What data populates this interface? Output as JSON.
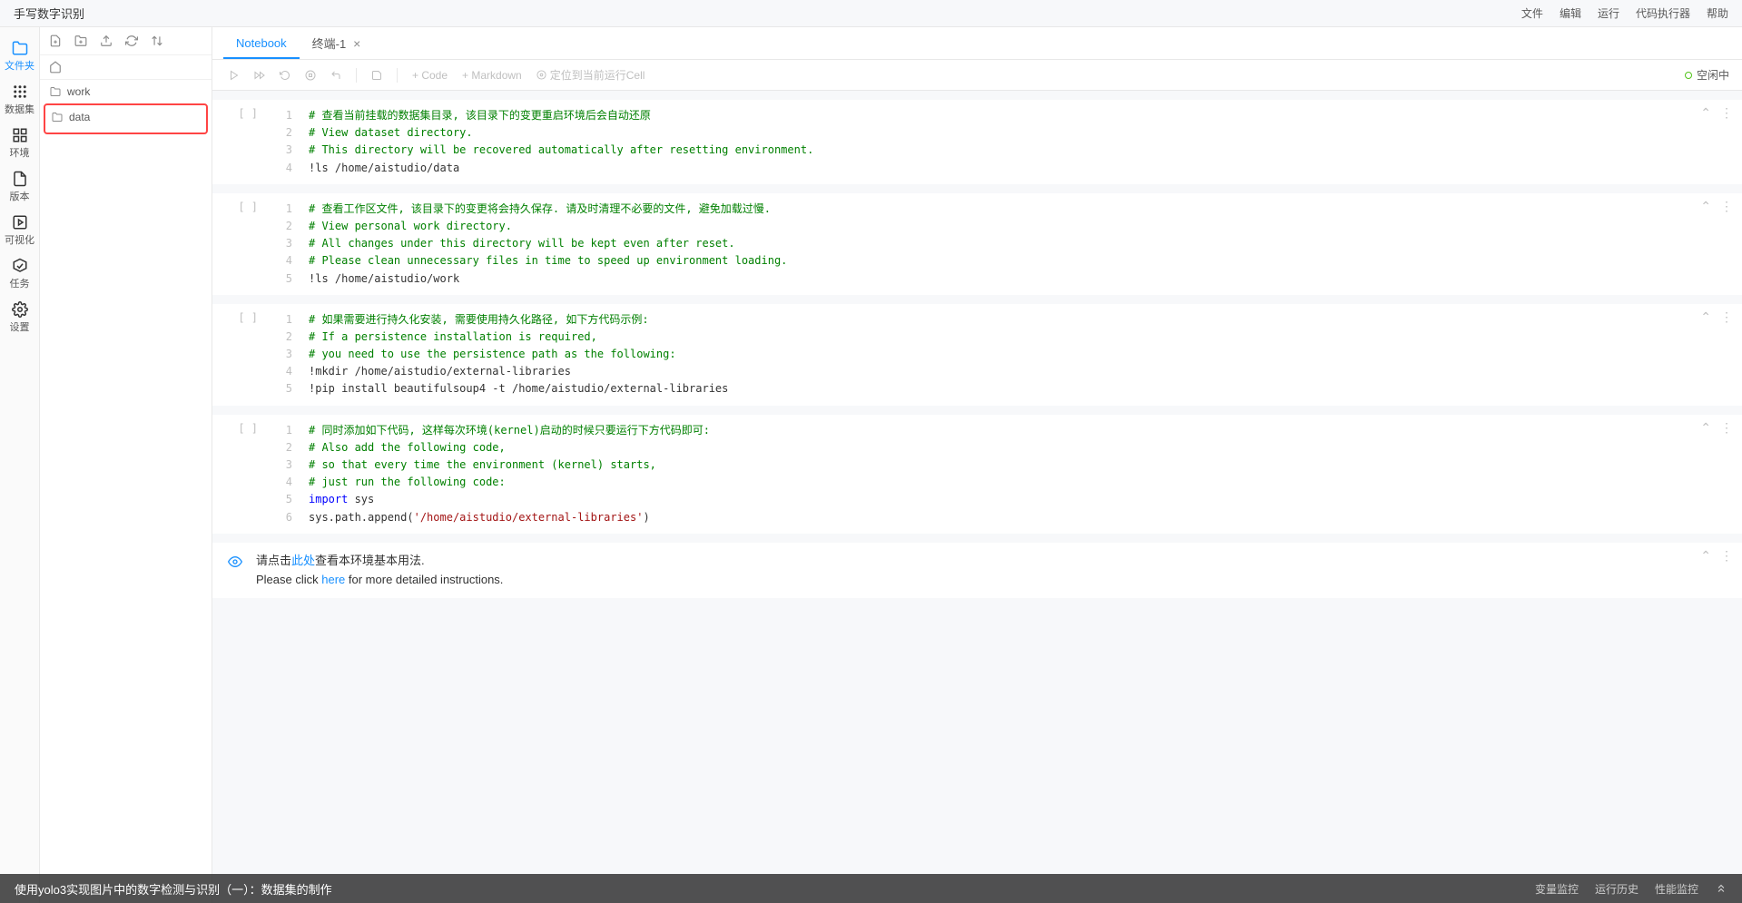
{
  "title": "手写数字识别",
  "topMenu": [
    "文件",
    "编辑",
    "运行",
    "代码执行器",
    "帮助"
  ],
  "iconSidebar": [
    {
      "label": "文件夹",
      "icon": "folder",
      "active": true
    },
    {
      "label": "数据集",
      "icon": "grid"
    },
    {
      "label": "环境",
      "icon": "apps"
    },
    {
      "label": "版本",
      "icon": "file"
    },
    {
      "label": "可视化",
      "icon": "play-box"
    },
    {
      "label": "任务",
      "icon": "check-box"
    },
    {
      "label": "设置",
      "icon": "gear"
    }
  ],
  "fileTree": {
    "items": [
      {
        "name": "work",
        "highlighted": false
      },
      {
        "name": "data",
        "highlighted": true
      }
    ]
  },
  "tabs": [
    {
      "label": "Notebook",
      "active": true,
      "closable": false
    },
    {
      "label": "终端-1",
      "active": false,
      "closable": true
    }
  ],
  "nbToolbar": {
    "addCode": "+ Code",
    "addMarkdown": "+ Markdown",
    "locate": "定位到当前运行Cell",
    "status": "空闲中"
  },
  "cells": [
    {
      "type": "code",
      "prompt": "[ ]",
      "lines": [
        [
          {
            "t": "# 查看当前挂载的数据集目录, 该目录下的变更重启环境后会自动还原",
            "c": "comment"
          }
        ],
        [
          {
            "t": "# View dataset directory.",
            "c": "comment"
          }
        ],
        [
          {
            "t": "# This directory will be recovered automatically after resetting environment.",
            "c": "comment"
          }
        ],
        [
          {
            "t": "!ls /home/aistudio/data",
            "c": "cmd"
          }
        ]
      ]
    },
    {
      "type": "code",
      "prompt": "[ ]",
      "lines": [
        [
          {
            "t": "# 查看工作区文件, 该目录下的变更将会持久保存. 请及时清理不必要的文件, 避免加载过慢.",
            "c": "comment"
          }
        ],
        [
          {
            "t": "# View personal work directory.",
            "c": "comment"
          }
        ],
        [
          {
            "t": "# All changes under this directory will be kept even after reset.",
            "c": "comment"
          }
        ],
        [
          {
            "t": "# Please clean unnecessary files in time to speed up environment loading.",
            "c": "comment"
          }
        ],
        [
          {
            "t": "!ls /home/aistudio/work",
            "c": "cmd"
          }
        ]
      ]
    },
    {
      "type": "code",
      "prompt": "[ ]",
      "lines": [
        [
          {
            "t": "# 如果需要进行持久化安装, 需要使用持久化路径, 如下方代码示例:",
            "c": "comment"
          }
        ],
        [
          {
            "t": "# If a persistence installation is required,",
            "c": "comment"
          }
        ],
        [
          {
            "t": "# you need to use the persistence path as the following:",
            "c": "comment"
          }
        ],
        [
          {
            "t": "!mkdir /home/aistudio/external-libraries",
            "c": "cmd"
          }
        ],
        [
          {
            "t": "!pip install beautifulsoup4 -t /home/aistudio/external-libraries",
            "c": "cmd"
          }
        ]
      ]
    },
    {
      "type": "code",
      "prompt": "[ ]",
      "lines": [
        [
          {
            "t": "# 同时添加如下代码, 这样每次环境(kernel)启动的时候只要运行下方代码即可:",
            "c": "comment"
          }
        ],
        [
          {
            "t": "# Also add the following code,",
            "c": "comment"
          }
        ],
        [
          {
            "t": "# so that every time the environment (kernel) starts,",
            "c": "comment"
          }
        ],
        [
          {
            "t": "# just run the following code:",
            "c": "comment"
          }
        ],
        [
          {
            "t": "import",
            "c": "keyword"
          },
          {
            "t": " sys",
            "c": "cmd"
          }
        ],
        [
          {
            "t": "sys.path.append(",
            "c": "cmd"
          },
          {
            "t": "'/home/aistudio/external-libraries'",
            "c": "string"
          },
          {
            "t": ")",
            "c": "cmd"
          }
        ]
      ]
    },
    {
      "type": "markdown",
      "zh_pre": "请点击",
      "zh_link": "此处",
      "zh_post": "查看本环境基本用法.",
      "en_pre": "Please click ",
      "en_link": "here",
      "en_post": " for more detailed instructions."
    }
  ],
  "bottomBar": {
    "title": "使用yolo3实现图片中的数字检测与识别（一）：数据集的制作",
    "right": [
      "变量监控",
      "运行历史",
      "性能监控"
    ]
  }
}
